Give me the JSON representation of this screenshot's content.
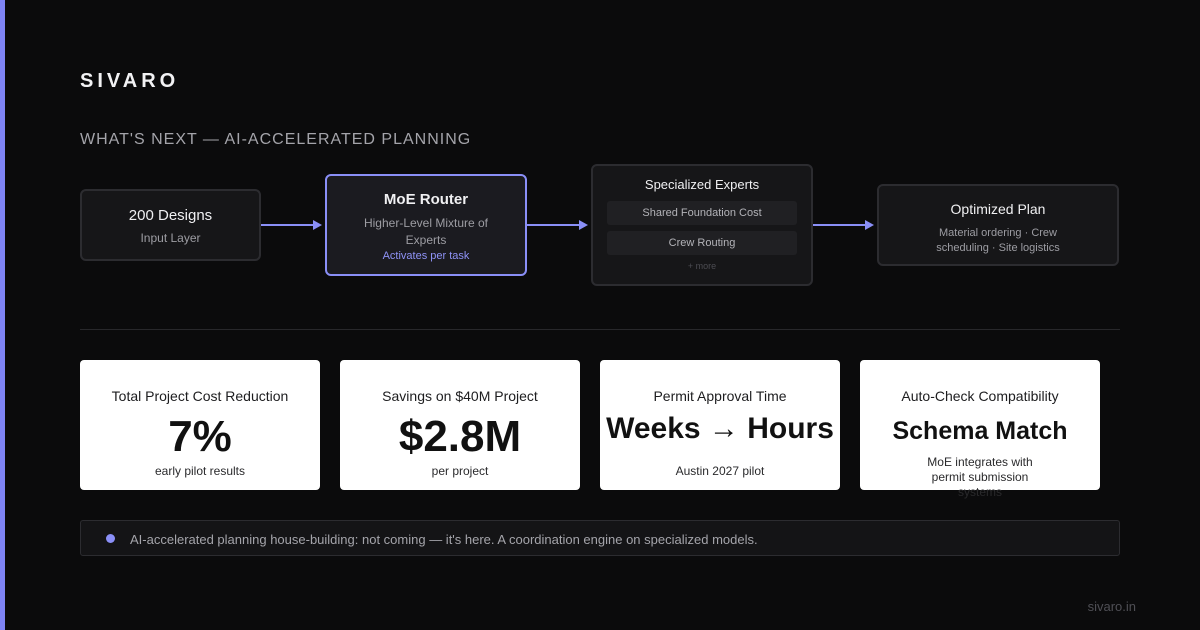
{
  "brand": "SIVARO",
  "section_title": "WHAT'S NEXT — AI-ACCELERATED PLANNING",
  "flow": {
    "input": {
      "title": "200 Designs",
      "sub": "Input Layer"
    },
    "router": {
      "title": "MoE Router",
      "sub": "Higher-Level Mixture of Experts",
      "tag": "Activates per task"
    },
    "experts": {
      "title": "Specialized Experts",
      "items": [
        "Shared Foundation Cost",
        "Crew Routing"
      ],
      "more": "+ more"
    },
    "plan": {
      "title": "Optimized Plan",
      "sub": "Material ordering · Crew scheduling · Site logistics"
    }
  },
  "metrics": [
    {
      "label": "Total Project Cost Reduction",
      "value": "7%",
      "note": "early pilot results"
    },
    {
      "label": "Savings on $40M Project",
      "value": "$2.8M",
      "note": "per project"
    },
    {
      "label": "Permit Approval Time",
      "value": "Weeks → Hours",
      "note": "Austin 2027 pilot"
    },
    {
      "label": "Auto-Check Compatibility",
      "value": "Schema Match",
      "note": "MoE integrates with permit submission systems"
    }
  ],
  "banner": "AI-accelerated planning house-building: not coming — it's here. A coordination engine on specialized models.",
  "footer": "sivaro.in",
  "colors": {
    "accent": "#7f84f5",
    "background": "#0b0b0c",
    "card": "#ffffff"
  }
}
